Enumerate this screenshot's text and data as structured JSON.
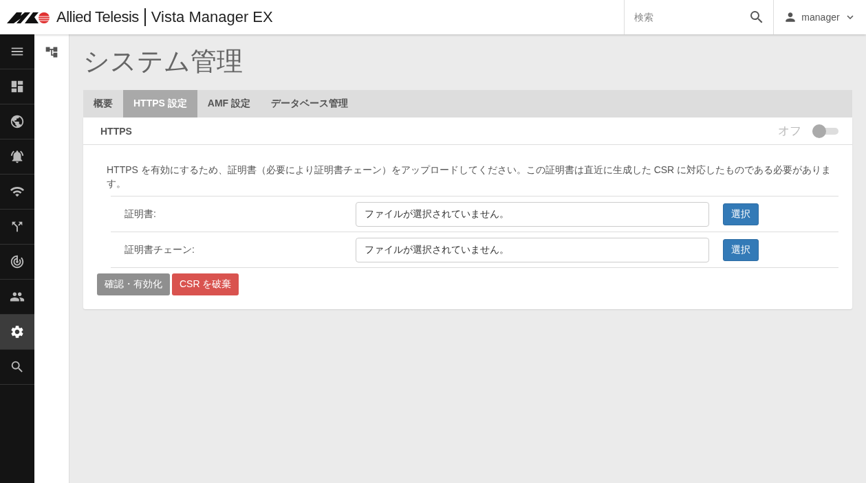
{
  "header": {
    "brand": "Allied Telesis",
    "product": "Vista Manager EX",
    "search": {
      "placeholder": "検索"
    },
    "user": "manager"
  },
  "sidebar": {
    "items": [
      {
        "kind": "menu",
        "selected": false
      },
      {
        "kind": "dashboard",
        "selected": false
      },
      {
        "kind": "globe",
        "selected": false
      },
      {
        "kind": "alarm",
        "selected": false
      },
      {
        "kind": "wifi",
        "selected": false
      },
      {
        "kind": "network",
        "selected": false
      },
      {
        "kind": "radar",
        "selected": false
      },
      {
        "kind": "users",
        "selected": false
      },
      {
        "kind": "settings",
        "selected": true
      },
      {
        "kind": "search",
        "selected": false
      }
    ]
  },
  "page": {
    "title": "システム管理",
    "tabs": [
      {
        "label": "概要",
        "selected": false
      },
      {
        "label": "HTTPS 設定",
        "selected": true
      },
      {
        "label": "AMF 設定",
        "selected": false
      },
      {
        "label": "データベース管理",
        "selected": false
      }
    ],
    "panel": {
      "title": "HTTPS",
      "toggle": {
        "label": "オフ",
        "on": false
      },
      "description": "HTTPS を有効にするため、証明書（必要により証明書チェーン）をアップロードしてください。この証明書は直近に生成した CSR に対応したものである必要があります。",
      "rows": [
        {
          "label": "証明書:",
          "value": "ファイルが選択されていません。",
          "button": "選択"
        },
        {
          "label": "証明書チェーン:",
          "value": "ファイルが選択されていません。",
          "button": "選択"
        }
      ],
      "actions": [
        {
          "label": "確認・有効化",
          "kind": "default",
          "disabled": true
        },
        {
          "label": "CSR を破棄",
          "kind": "danger",
          "disabled": false
        }
      ]
    }
  }
}
